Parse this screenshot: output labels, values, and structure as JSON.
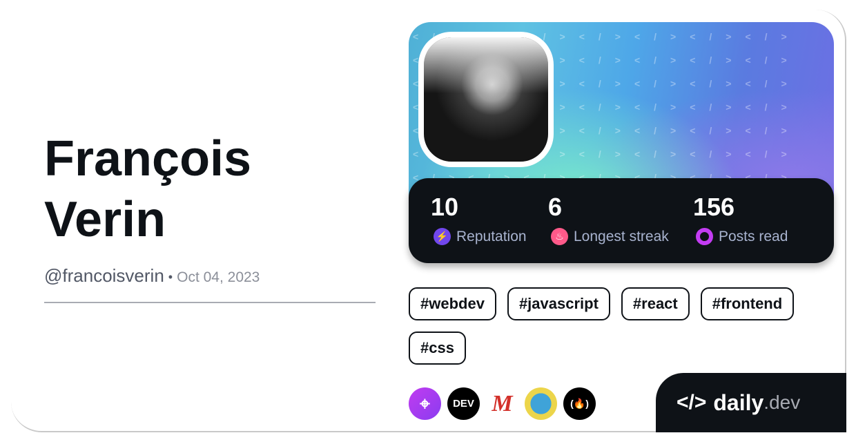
{
  "profile": {
    "name_line1": "François",
    "name_line2": "Verin",
    "handle": "@francoisverin",
    "separator": "•",
    "joined": "Oct 04, 2023"
  },
  "stats": [
    {
      "value": "10",
      "label": "Reputation",
      "icon": "lightning-icon",
      "color": "#7147ed"
    },
    {
      "value": "6",
      "label": "Longest streak",
      "icon": "flame-icon",
      "color": "#ff5a8a"
    },
    {
      "value": "156",
      "label": "Posts read",
      "icon": "ring-icon",
      "color": "#c33cf2"
    }
  ],
  "tags": [
    "#webdev",
    "#javascript",
    "#react",
    "#frontend",
    "#css"
  ],
  "sources": [
    {
      "name": "crosshair-source",
      "label": "",
      "color": "#a83cf0"
    },
    {
      "name": "dev-to-source",
      "label": "DEV",
      "color": "#000000"
    },
    {
      "name": "m-source",
      "label": "M",
      "color": "#ffffff"
    },
    {
      "name": "robot-source",
      "label": "",
      "color": "#e9d44a"
    },
    {
      "name": "freecodecamp-source",
      "label": "(🔥)",
      "color": "#000000"
    }
  ],
  "brand": {
    "mark": "</>",
    "name": "daily",
    ".dev": ".dev",
    "suffix": ".dev"
  }
}
